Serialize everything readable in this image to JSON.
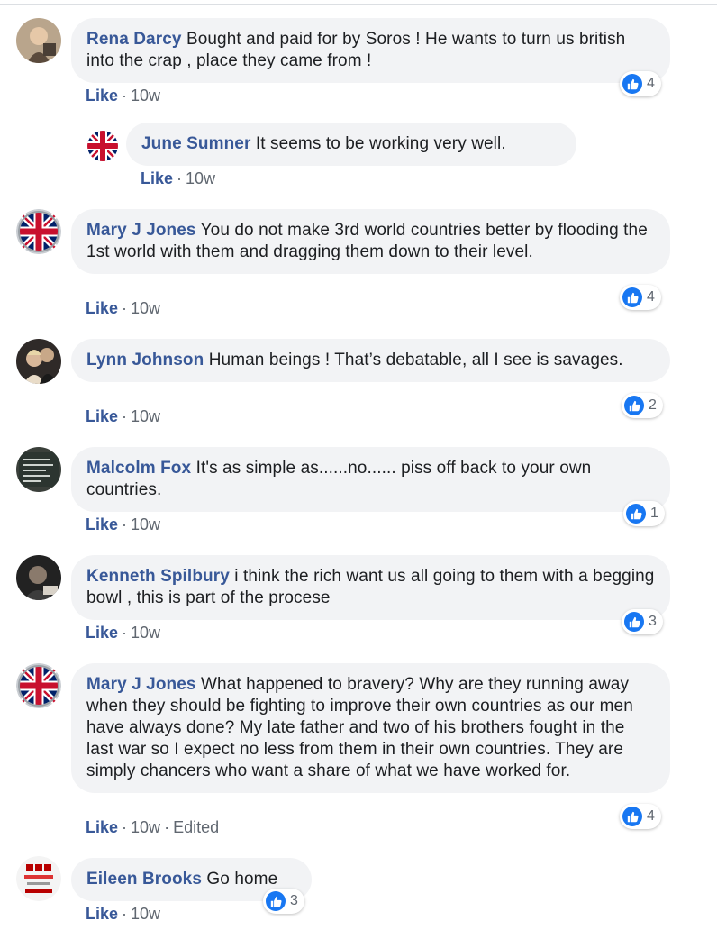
{
  "colors": {
    "author": "#385898",
    "bubble": "#f2f3f5",
    "like_blue": "#1877f2",
    "meta_gray": "#606770"
  },
  "comments": [
    {
      "author": "Rena Darcy",
      "text": "Bought and paid for by Soros ! He wants to turn us british into the crap , place they came from !",
      "like_label": "Like",
      "time": "10w",
      "reactions": "4",
      "avatar": "photo-avatar"
    },
    {
      "author": "June Sumner",
      "text": "It seems to be working very well.",
      "like_label": "Like",
      "time": "10w",
      "avatar": "union-jack-flag-avatar"
    },
    {
      "author": "Mary J Jones",
      "text": "You do not make 3rd world countries better by flooding the 1st world with them and dragging them down to their level.",
      "like_label": "Like",
      "time": "10w",
      "reactions": "4",
      "avatar": "union-jack-badge-avatar"
    },
    {
      "author": "Lynn Johnson",
      "text": "Human beings ! That’s debatable, all I see is savages.",
      "like_label": "Like",
      "time": "10w",
      "reactions": "2",
      "avatar": "photo-avatar"
    },
    {
      "author": "Malcolm Fox",
      "text": "It's as simple as......no...... piss off back to your own countries.",
      "like_label": "Like",
      "time": "10w",
      "reactions": "1",
      "avatar": "chalkboard-photo-avatar"
    },
    {
      "author": "Kenneth Spilbury",
      "text": "i think the rich want us all going to them with a begging bowl , this is part of the procese",
      "like_label": "Like",
      "time": "10w",
      "reactions": "3",
      "avatar": "photo-avatar"
    },
    {
      "author": "Mary J Jones",
      "text": "What happened to bravery? Why are they running away when they should be fighting to improve their own countries as our men have always done? My late father and two of his brothers fought in the last war so I expect no less from them in their own countries. They are simply chancers who want a share of what we have worked for.",
      "like_label": "Like",
      "time": "10w",
      "edited": "Edited",
      "reactions": "4",
      "avatar": "union-jack-badge-avatar"
    },
    {
      "author": "Eileen Brooks",
      "text": "Go home",
      "like_label": "Like",
      "time": "10w",
      "reactions": "3",
      "avatar": "bbc-news-logo-avatar"
    }
  ]
}
